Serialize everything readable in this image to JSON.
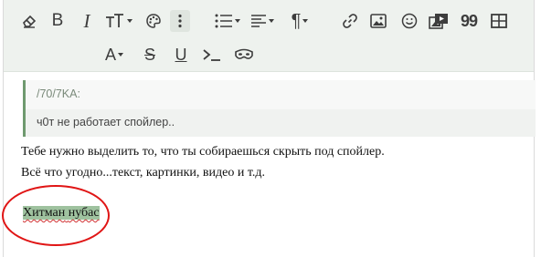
{
  "toolbar": {
    "row1": [
      {
        "name": "eraser-icon"
      },
      {
        "name": "bold-button",
        "label": "B"
      },
      {
        "name": "italic-button",
        "label": "I"
      },
      {
        "name": "font-size-dropdown"
      },
      {
        "name": "palette-icon"
      },
      {
        "name": "more-vertical-icon"
      },
      {
        "name": "list-dropdown"
      },
      {
        "name": "align-dropdown"
      },
      {
        "name": "paragraph-dropdown",
        "label": "¶"
      },
      {
        "name": "link-icon"
      },
      {
        "name": "image-icon"
      },
      {
        "name": "smiley-icon"
      },
      {
        "name": "media-icon"
      },
      {
        "name": "quote-icon",
        "label": "99"
      },
      {
        "name": "table-icon"
      }
    ],
    "row2": [
      {
        "name": "text-color-dropdown",
        "label": "A"
      },
      {
        "name": "strikethrough-button",
        "label": "S"
      },
      {
        "name": "underline-button",
        "label": "U"
      },
      {
        "name": "code-icon"
      },
      {
        "name": "spoiler-mask-icon"
      }
    ]
  },
  "quote": {
    "author": "/70/7KA:",
    "text": "ч0т не работает спойлер.."
  },
  "body": {
    "line1": "Тебе нужно выделить то, что ты собираешься скрыть под спойлер.",
    "line2": "Всё что угодно...текст, картинки, видео и т.д.",
    "highlight_word1": "Хитман",
    "highlight_word2": "нубас"
  },
  "colors": {
    "toolbar_bg": "#eef2ee",
    "quote_border": "#6f9a6f",
    "highlight": "#9fc29f",
    "annotation_circle": "#e01515"
  }
}
